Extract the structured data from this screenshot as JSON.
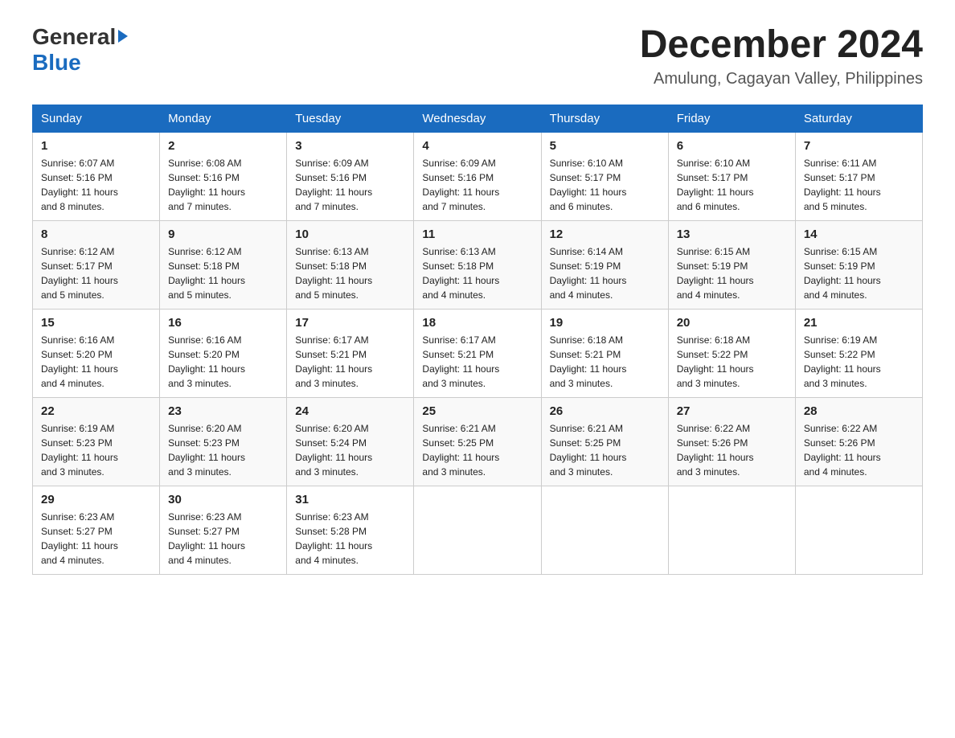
{
  "header": {
    "logo_general": "General",
    "logo_blue": "Blue",
    "month_title": "December 2024",
    "location": "Amulung, Cagayan Valley, Philippines"
  },
  "days_of_week": [
    "Sunday",
    "Monday",
    "Tuesday",
    "Wednesday",
    "Thursday",
    "Friday",
    "Saturday"
  ],
  "weeks": [
    [
      {
        "day": "1",
        "sunrise": "6:07 AM",
        "sunset": "5:16 PM",
        "daylight": "11 hours and 8 minutes."
      },
      {
        "day": "2",
        "sunrise": "6:08 AM",
        "sunset": "5:16 PM",
        "daylight": "11 hours and 7 minutes."
      },
      {
        "day": "3",
        "sunrise": "6:09 AM",
        "sunset": "5:16 PM",
        "daylight": "11 hours and 7 minutes."
      },
      {
        "day": "4",
        "sunrise": "6:09 AM",
        "sunset": "5:16 PM",
        "daylight": "11 hours and 7 minutes."
      },
      {
        "day": "5",
        "sunrise": "6:10 AM",
        "sunset": "5:17 PM",
        "daylight": "11 hours and 6 minutes."
      },
      {
        "day": "6",
        "sunrise": "6:10 AM",
        "sunset": "5:17 PM",
        "daylight": "11 hours and 6 minutes."
      },
      {
        "day": "7",
        "sunrise": "6:11 AM",
        "sunset": "5:17 PM",
        "daylight": "11 hours and 5 minutes."
      }
    ],
    [
      {
        "day": "8",
        "sunrise": "6:12 AM",
        "sunset": "5:17 PM",
        "daylight": "11 hours and 5 minutes."
      },
      {
        "day": "9",
        "sunrise": "6:12 AM",
        "sunset": "5:18 PM",
        "daylight": "11 hours and 5 minutes."
      },
      {
        "day": "10",
        "sunrise": "6:13 AM",
        "sunset": "5:18 PM",
        "daylight": "11 hours and 5 minutes."
      },
      {
        "day": "11",
        "sunrise": "6:13 AM",
        "sunset": "5:18 PM",
        "daylight": "11 hours and 4 minutes."
      },
      {
        "day": "12",
        "sunrise": "6:14 AM",
        "sunset": "5:19 PM",
        "daylight": "11 hours and 4 minutes."
      },
      {
        "day": "13",
        "sunrise": "6:15 AM",
        "sunset": "5:19 PM",
        "daylight": "11 hours and 4 minutes."
      },
      {
        "day": "14",
        "sunrise": "6:15 AM",
        "sunset": "5:19 PM",
        "daylight": "11 hours and 4 minutes."
      }
    ],
    [
      {
        "day": "15",
        "sunrise": "6:16 AM",
        "sunset": "5:20 PM",
        "daylight": "11 hours and 4 minutes."
      },
      {
        "day": "16",
        "sunrise": "6:16 AM",
        "sunset": "5:20 PM",
        "daylight": "11 hours and 3 minutes."
      },
      {
        "day": "17",
        "sunrise": "6:17 AM",
        "sunset": "5:21 PM",
        "daylight": "11 hours and 3 minutes."
      },
      {
        "day": "18",
        "sunrise": "6:17 AM",
        "sunset": "5:21 PM",
        "daylight": "11 hours and 3 minutes."
      },
      {
        "day": "19",
        "sunrise": "6:18 AM",
        "sunset": "5:21 PM",
        "daylight": "11 hours and 3 minutes."
      },
      {
        "day": "20",
        "sunrise": "6:18 AM",
        "sunset": "5:22 PM",
        "daylight": "11 hours and 3 minutes."
      },
      {
        "day": "21",
        "sunrise": "6:19 AM",
        "sunset": "5:22 PM",
        "daylight": "11 hours and 3 minutes."
      }
    ],
    [
      {
        "day": "22",
        "sunrise": "6:19 AM",
        "sunset": "5:23 PM",
        "daylight": "11 hours and 3 minutes."
      },
      {
        "day": "23",
        "sunrise": "6:20 AM",
        "sunset": "5:23 PM",
        "daylight": "11 hours and 3 minutes."
      },
      {
        "day": "24",
        "sunrise": "6:20 AM",
        "sunset": "5:24 PM",
        "daylight": "11 hours and 3 minutes."
      },
      {
        "day": "25",
        "sunrise": "6:21 AM",
        "sunset": "5:25 PM",
        "daylight": "11 hours and 3 minutes."
      },
      {
        "day": "26",
        "sunrise": "6:21 AM",
        "sunset": "5:25 PM",
        "daylight": "11 hours and 3 minutes."
      },
      {
        "day": "27",
        "sunrise": "6:22 AM",
        "sunset": "5:26 PM",
        "daylight": "11 hours and 3 minutes."
      },
      {
        "day": "28",
        "sunrise": "6:22 AM",
        "sunset": "5:26 PM",
        "daylight": "11 hours and 4 minutes."
      }
    ],
    [
      {
        "day": "29",
        "sunrise": "6:23 AM",
        "sunset": "5:27 PM",
        "daylight": "11 hours and 4 minutes."
      },
      {
        "day": "30",
        "sunrise": "6:23 AM",
        "sunset": "5:27 PM",
        "daylight": "11 hours and 4 minutes."
      },
      {
        "day": "31",
        "sunrise": "6:23 AM",
        "sunset": "5:28 PM",
        "daylight": "11 hours and 4 minutes."
      },
      null,
      null,
      null,
      null
    ]
  ],
  "labels": {
    "sunrise": "Sunrise:",
    "sunset": "Sunset:",
    "daylight": "Daylight:"
  }
}
